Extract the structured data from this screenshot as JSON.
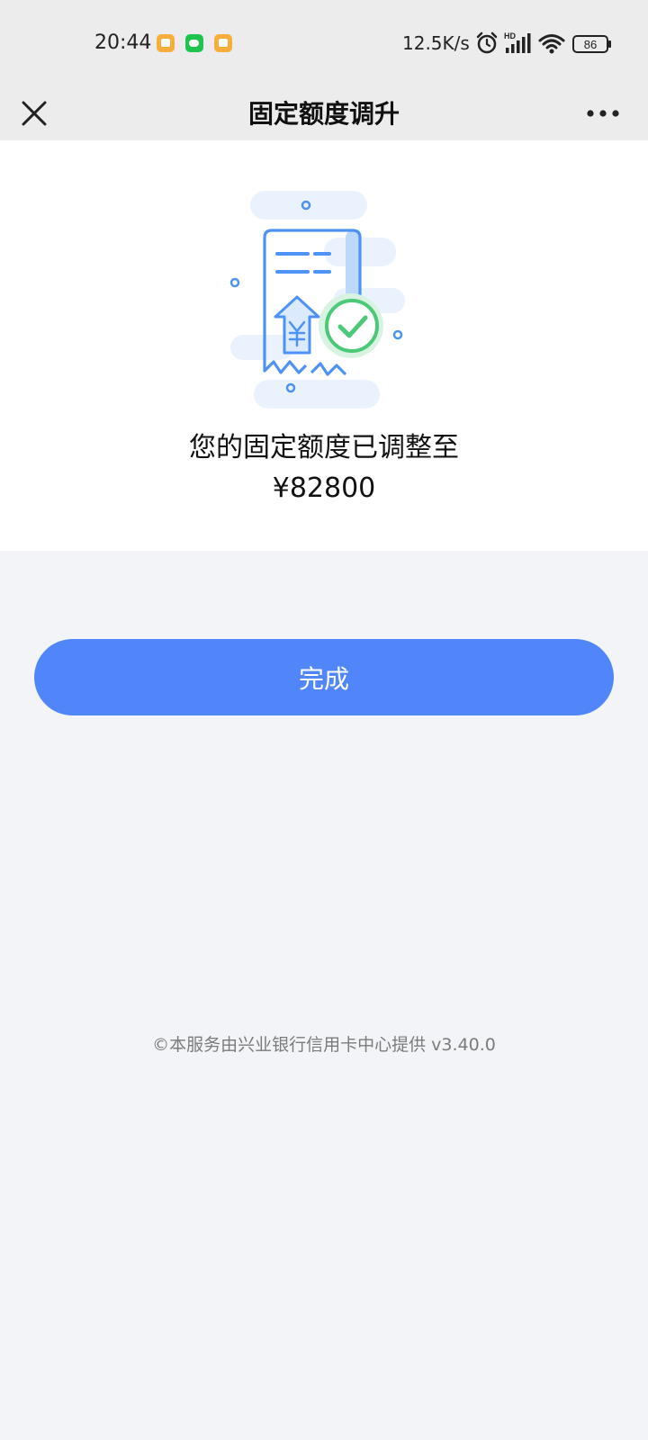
{
  "status_bar": {
    "time": "20:44",
    "net_speed": "12.5K/s",
    "battery": "86",
    "signal_label": "HD",
    "icons": [
      "orange-notification-icon",
      "wechat-icon",
      "orange-notification-icon",
      "alarm-icon",
      "signal-icon",
      "wifi-icon",
      "battery-icon"
    ]
  },
  "nav": {
    "title": "固定额度调升",
    "close_icon": "close-icon",
    "more_icon": "more-icon"
  },
  "result": {
    "message": "您的固定额度已调整至",
    "amount": "¥82800",
    "illustration_icon": "receipt-success-icon"
  },
  "actions": {
    "done_label": "完成"
  },
  "footer": {
    "text": "©本服务由兴业银行信用卡中心提供 v3.40.0"
  },
  "colors": {
    "primary_button": "#5186fb",
    "nav_background": "#ececec",
    "page_background": "#f2f4f8",
    "illustration_blue": "#4d93f5",
    "success_green": "#4cc879"
  }
}
